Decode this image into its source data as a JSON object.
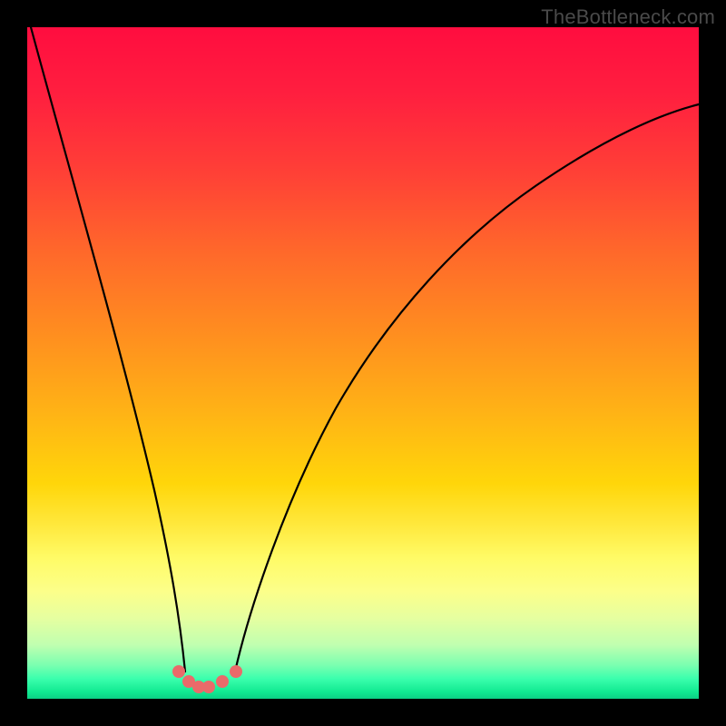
{
  "watermark": "TheBottleneck.com",
  "colors": {
    "background_black": "#000000",
    "gradient_top": "#ff0d3f",
    "gradient_bottom": "#0ccf85",
    "curve_stroke": "#000000",
    "dot_fill": "#ea6a6a"
  },
  "chart_data": {
    "type": "line",
    "title": "",
    "xlabel": "",
    "ylabel": "",
    "xlim": [
      0,
      1
    ],
    "ylim": [
      0,
      1
    ],
    "note": "Axes and tick labels are not shown in the image; x and y are normalized to the colored plot area. Two black curves descend to a common minimum near x≈0.27, where a small cluster of pink dots sits at the bottom.",
    "series": [
      {
        "name": "left-branch",
        "x": [
          0.005,
          0.03,
          0.06,
          0.09,
          0.12,
          0.15,
          0.18,
          0.206,
          0.225,
          0.235
        ],
        "y": [
          1.0,
          0.89,
          0.78,
          0.67,
          0.55,
          0.43,
          0.3,
          0.15,
          0.07,
          0.04
        ]
      },
      {
        "name": "right-branch",
        "x": [
          0.31,
          0.33,
          0.36,
          0.4,
          0.45,
          0.5,
          0.56,
          0.63,
          0.72,
          0.82,
          0.92,
          1.0
        ],
        "y": [
          0.04,
          0.08,
          0.16,
          0.27,
          0.38,
          0.48,
          0.56,
          0.64,
          0.72,
          0.79,
          0.845,
          0.885
        ]
      }
    ],
    "markers": {
      "name": "bottom-dots",
      "x": [
        0.225,
        0.24,
        0.255,
        0.27,
        0.29,
        0.31
      ],
      "y": [
        0.04,
        0.025,
        0.018,
        0.018,
        0.025,
        0.04
      ]
    }
  }
}
